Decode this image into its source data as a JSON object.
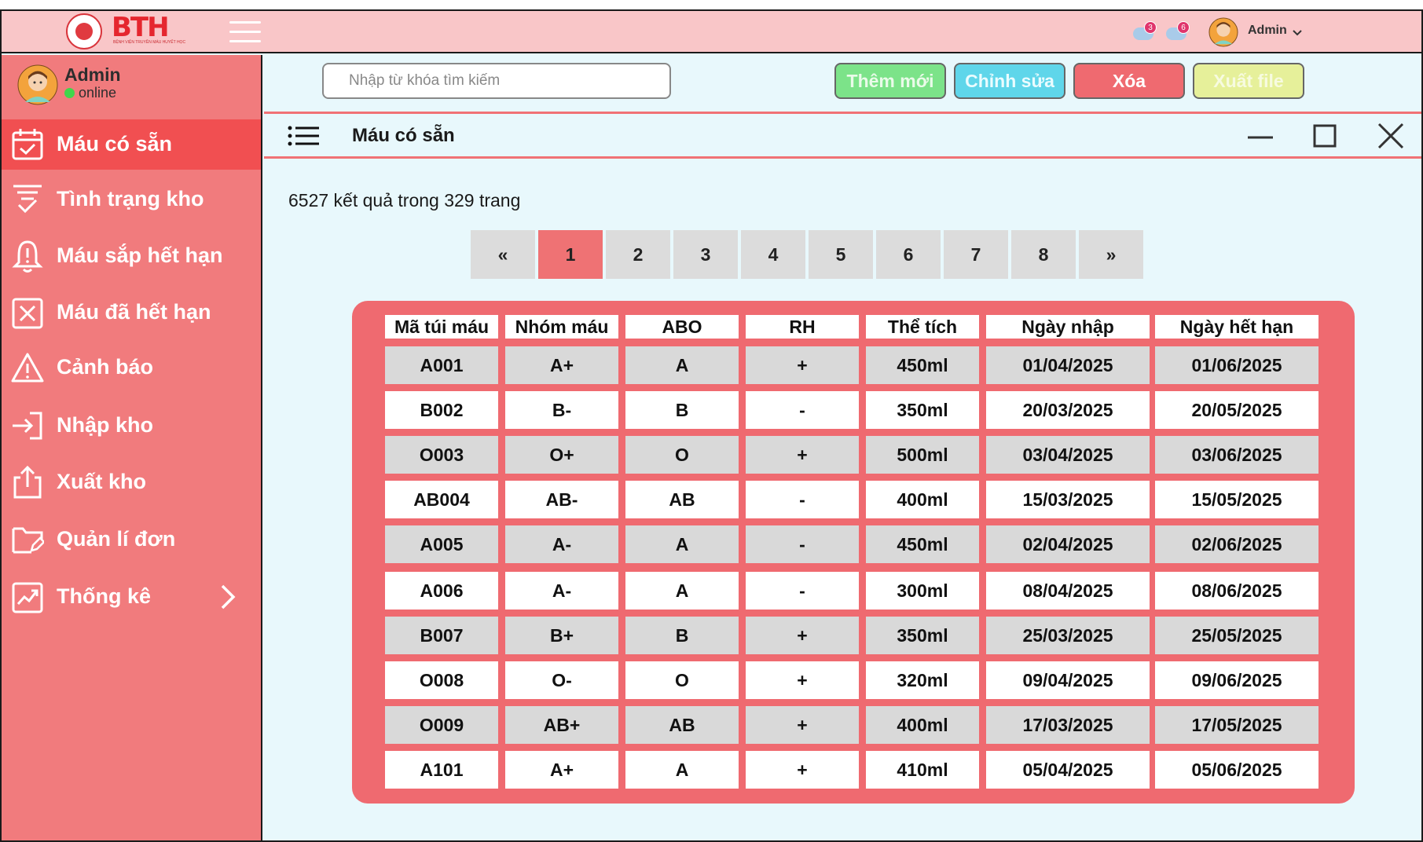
{
  "header": {
    "logo_text": "BTH",
    "logo_sub": "BỆNH VIỆN TRUYỀN MÁU HUYẾT HỌC",
    "notif1_count": "3",
    "notif2_count": "6",
    "user_label": "Admin"
  },
  "sidebar": {
    "user_name": "Admin",
    "user_status": "online",
    "items": [
      {
        "label": "Máu có sẵn",
        "icon": "calendar-check-icon",
        "active": true
      },
      {
        "label": "Tình trạng kho",
        "icon": "funnel-check-icon"
      },
      {
        "label": "Máu sắp hết hạn",
        "icon": "bell-alert-icon"
      },
      {
        "label": "Máu đã hết hạn",
        "icon": "x-square-icon"
      },
      {
        "label": "Cảnh báo",
        "icon": "warning-triangle-icon"
      },
      {
        "label": "Nhập kho",
        "icon": "sign-in-icon"
      },
      {
        "label": "Xuất kho",
        "icon": "share-upload-icon"
      },
      {
        "label": "Quản lí đơn",
        "icon": "folder-edit-icon"
      },
      {
        "label": "Thống kê",
        "icon": "chart-trend-icon"
      }
    ]
  },
  "toolbar": {
    "search_placeholder": "Nhập từ khóa tìm kiếm",
    "add_label": "Thêm mới",
    "edit_label": "Chỉnh sửa",
    "delete_label": "Xóa",
    "export_label": "Xuất file",
    "colors": {
      "add": "#7ce389",
      "edit": "#5fd6ea",
      "delete": "#ef6a70",
      "export": "#e6f09a"
    }
  },
  "panel": {
    "title": "Máu có sẵn",
    "result_text": "6527 kết quả trong 329 trang"
  },
  "pagination": {
    "first": "«",
    "pages": [
      "1",
      "2",
      "3",
      "4",
      "5",
      "6",
      "7",
      "8"
    ],
    "last": "»",
    "current": "1"
  },
  "table": {
    "headers": [
      "Mã túi máu",
      "Nhóm máu",
      "ABO",
      "RH",
      "Thể tích",
      "Ngày nhập",
      "Ngày hết hạn"
    ],
    "rows": [
      [
        "A001",
        "A+",
        "A",
        "+",
        "450ml",
        "01/04/2025",
        "01/06/2025"
      ],
      [
        "B002",
        "B-",
        "B",
        "-",
        "350ml",
        "20/03/2025",
        "20/05/2025"
      ],
      [
        "O003",
        "O+",
        "O",
        "+",
        "500ml",
        "03/04/2025",
        "03/06/2025"
      ],
      [
        "AB004",
        "AB-",
        "AB",
        "-",
        "400ml",
        "15/03/2025",
        "15/05/2025"
      ],
      [
        "A005",
        "A-",
        "A",
        "-",
        "450ml",
        "02/04/2025",
        "02/06/2025"
      ],
      [
        "A006",
        "A-",
        "A",
        "-",
        "300ml",
        "08/04/2025",
        "08/06/2025"
      ],
      [
        "B007",
        "B+",
        "B",
        "+",
        "350ml",
        "25/03/2025",
        "25/05/2025"
      ],
      [
        "O008",
        "O-",
        "O",
        "+",
        "320ml",
        "09/04/2025",
        "09/06/2025"
      ],
      [
        "O009",
        "AB+",
        "AB",
        "+",
        "400ml",
        "17/03/2025",
        "17/05/2025"
      ],
      [
        "A101",
        "A+",
        "A",
        "+",
        "410ml",
        "05/04/2025",
        "05/06/2025"
      ]
    ]
  }
}
